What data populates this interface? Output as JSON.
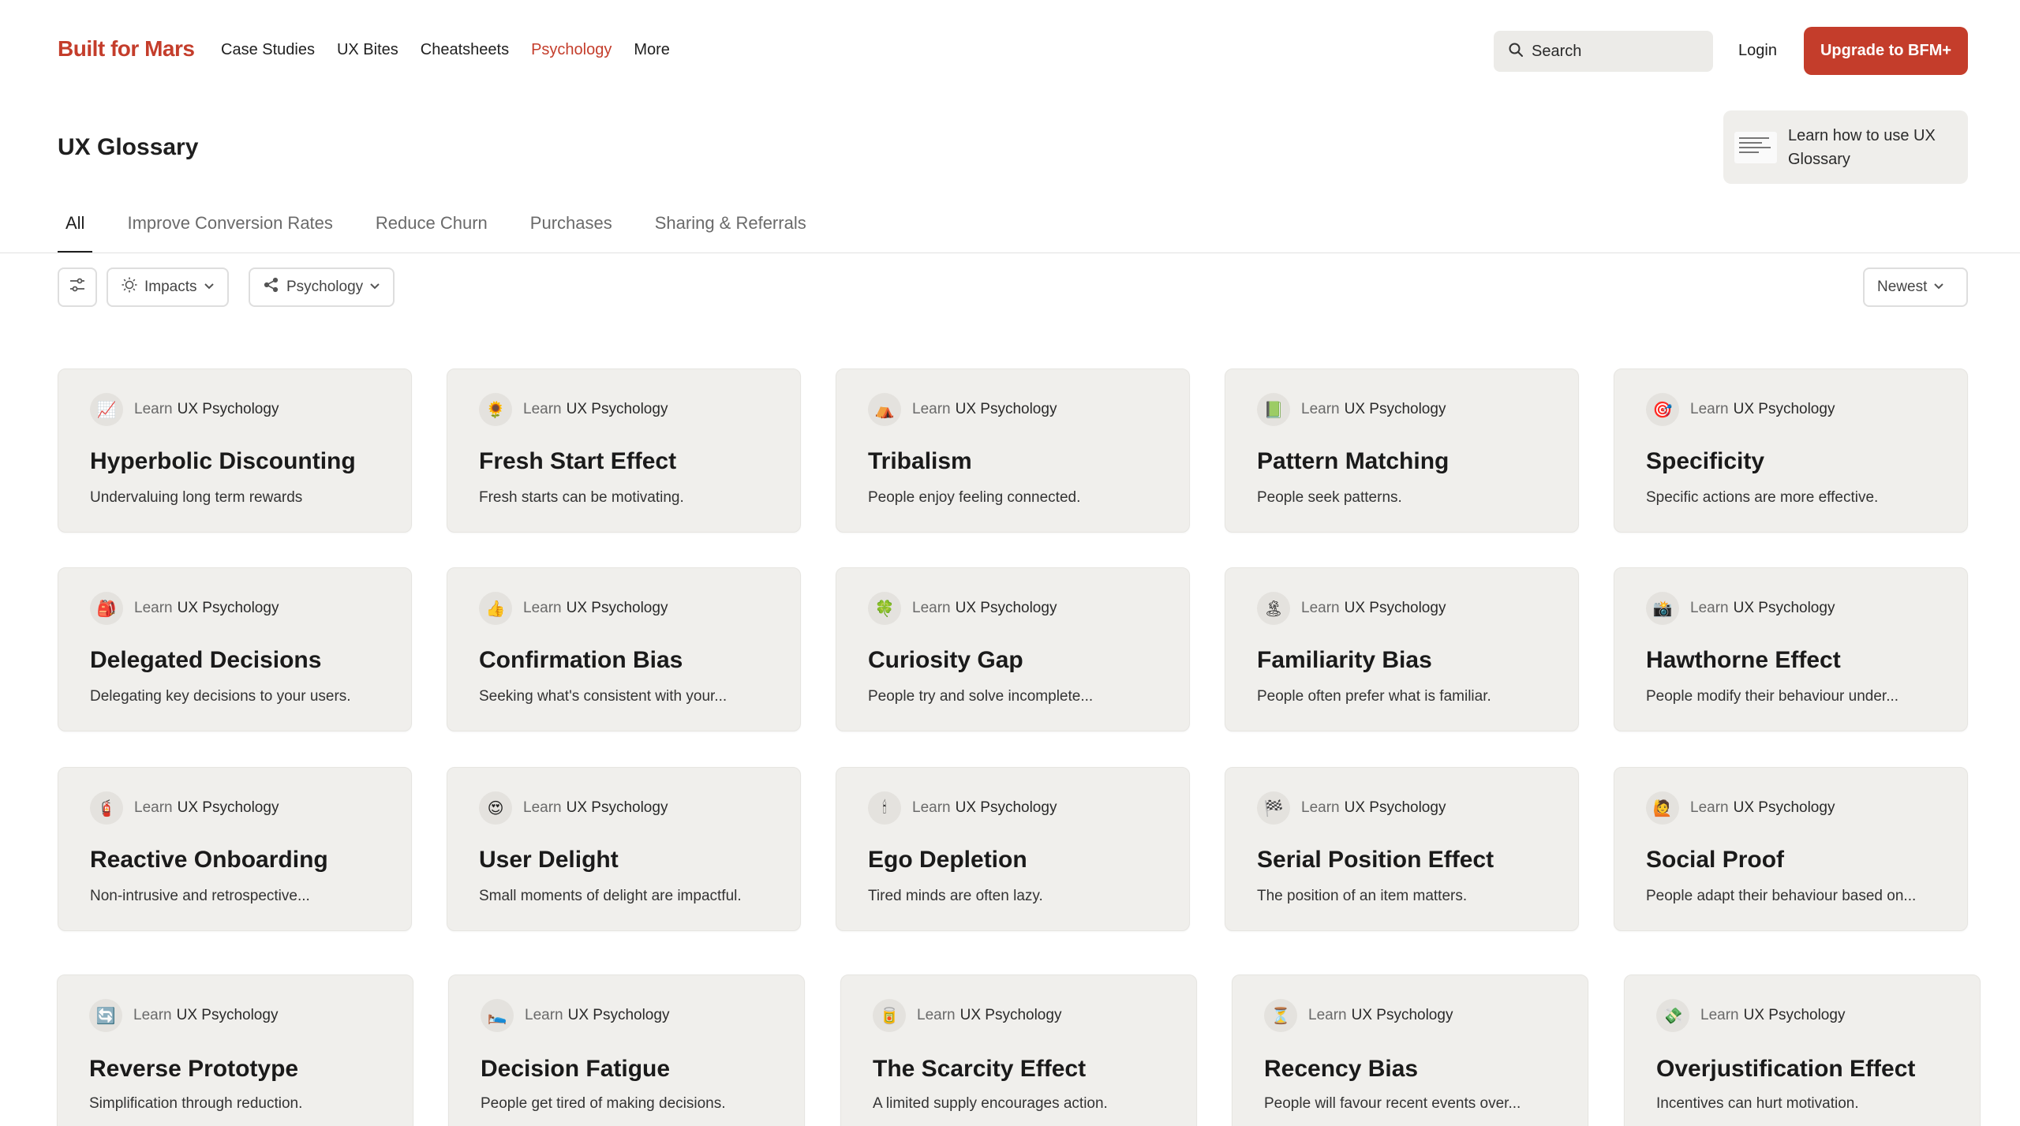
{
  "header": {
    "logo": "Built for Mars",
    "nav": [
      "Case Studies",
      "UX Bites",
      "Cheatsheets",
      "Psychology",
      "More"
    ],
    "active_nav": "Psychology",
    "search_placeholder": "Search",
    "login": "Login",
    "upgrade": "Upgrade to BFM+",
    "accent": "#c43d2b"
  },
  "page": {
    "title": "UX Glossary",
    "learn_link": "Learn how to use UX Glossary"
  },
  "tabs": [
    "All",
    "Improve Conversion Rates",
    "Reduce Churn",
    "Purchases",
    "Sharing & Referrals"
  ],
  "filters": {
    "settings_icon": "sliders-icon",
    "impacts": "Impacts",
    "psychology": "Psychology",
    "sort": "Newest"
  },
  "card_meta": {
    "learn": "Learn",
    "category": "UX Psychology"
  },
  "cards": [
    {
      "icon": "📈",
      "title": "Hyperbolic Discounting",
      "desc": "Undervaluing long term rewards"
    },
    {
      "icon": "🌻",
      "title": "Fresh Start Effect",
      "desc": "Fresh starts can be motivating."
    },
    {
      "icon": "⛺",
      "title": "Tribalism",
      "desc": "People enjoy feeling connected."
    },
    {
      "icon": "📗",
      "title": "Pattern Matching",
      "desc": "People seek patterns."
    },
    {
      "icon": "🎯",
      "title": "Specificity",
      "desc": "Specific actions are more effective."
    },
    {
      "icon": "🎒",
      "title": "Delegated Decisions",
      "desc": "Delegating key decisions to your users."
    },
    {
      "icon": "👍",
      "title": "Confirmation Bias",
      "desc": "Seeking what's consistent with your..."
    },
    {
      "icon": "🍀",
      "title": "Curiosity Gap",
      "desc": "People try and solve incomplete..."
    },
    {
      "icon": "🏝",
      "title": "Familiarity Bias",
      "desc": "People often prefer what is familiar."
    },
    {
      "icon": "📸",
      "title": "Hawthorne Effect",
      "desc": "People modify their behaviour under..."
    },
    {
      "icon": "🧯",
      "title": "Reactive Onboarding",
      "desc": "Non-intrusive and retrospective..."
    },
    {
      "icon": "😍",
      "title": "User Delight",
      "desc": "Small moments of delight are impactful."
    },
    {
      "icon": "🕯",
      "title": "Ego Depletion",
      "desc": "Tired minds are often lazy."
    },
    {
      "icon": "🏁",
      "title": "Serial Position Effect",
      "desc": "The position of an item matters."
    },
    {
      "icon": "🙋",
      "title": "Social Proof",
      "desc": "People adapt their behaviour based on..."
    },
    {
      "icon": "🔄",
      "title": "Reverse Prototype",
      "desc": "Simplification through reduction."
    },
    {
      "icon": "🛌",
      "title": "Decision Fatigue",
      "desc": "People get tired of making decisions."
    },
    {
      "icon": "🥫",
      "title": "The Scarcity Effect",
      "desc": "A limited supply encourages action."
    },
    {
      "icon": "⏳",
      "title": "Recency Bias",
      "desc": "People will favour recent events over..."
    },
    {
      "icon": "💸",
      "title": "Overjustification Effect",
      "desc": "Incentives can hurt motivation."
    }
  ]
}
